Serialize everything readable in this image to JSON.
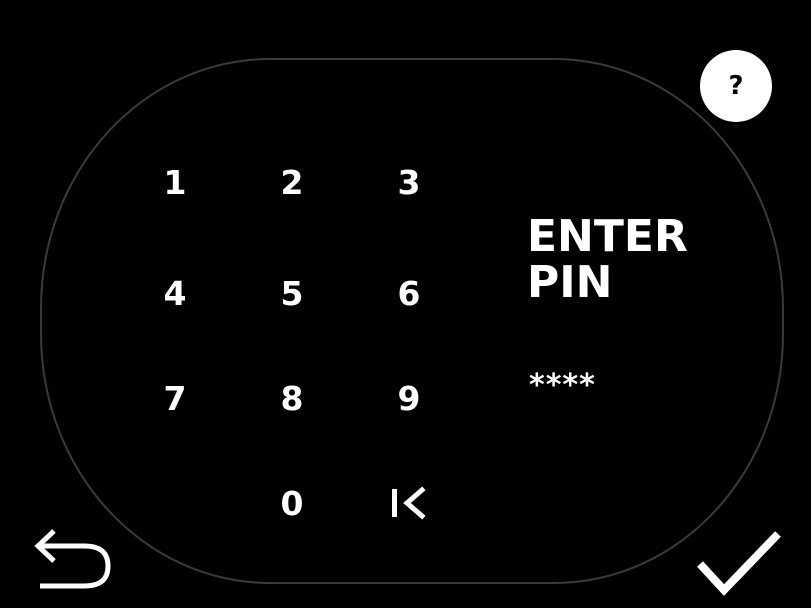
{
  "help": {
    "label": "?"
  },
  "keypad": {
    "keys": [
      "1",
      "2",
      "3",
      "4",
      "5",
      "6",
      "7",
      "8",
      "9",
      "0"
    ]
  },
  "prompt": {
    "line1": "ENTER",
    "line2": "PIN"
  },
  "pin": {
    "masked_value": "****"
  },
  "icons": {
    "help": "help-icon",
    "backspace": "backspace-icon",
    "back": "back-arrow-icon",
    "confirm": "checkmark-icon"
  },
  "colors": {
    "background": "#000000",
    "foreground": "#ffffff",
    "outline": "#3a3a3a"
  }
}
